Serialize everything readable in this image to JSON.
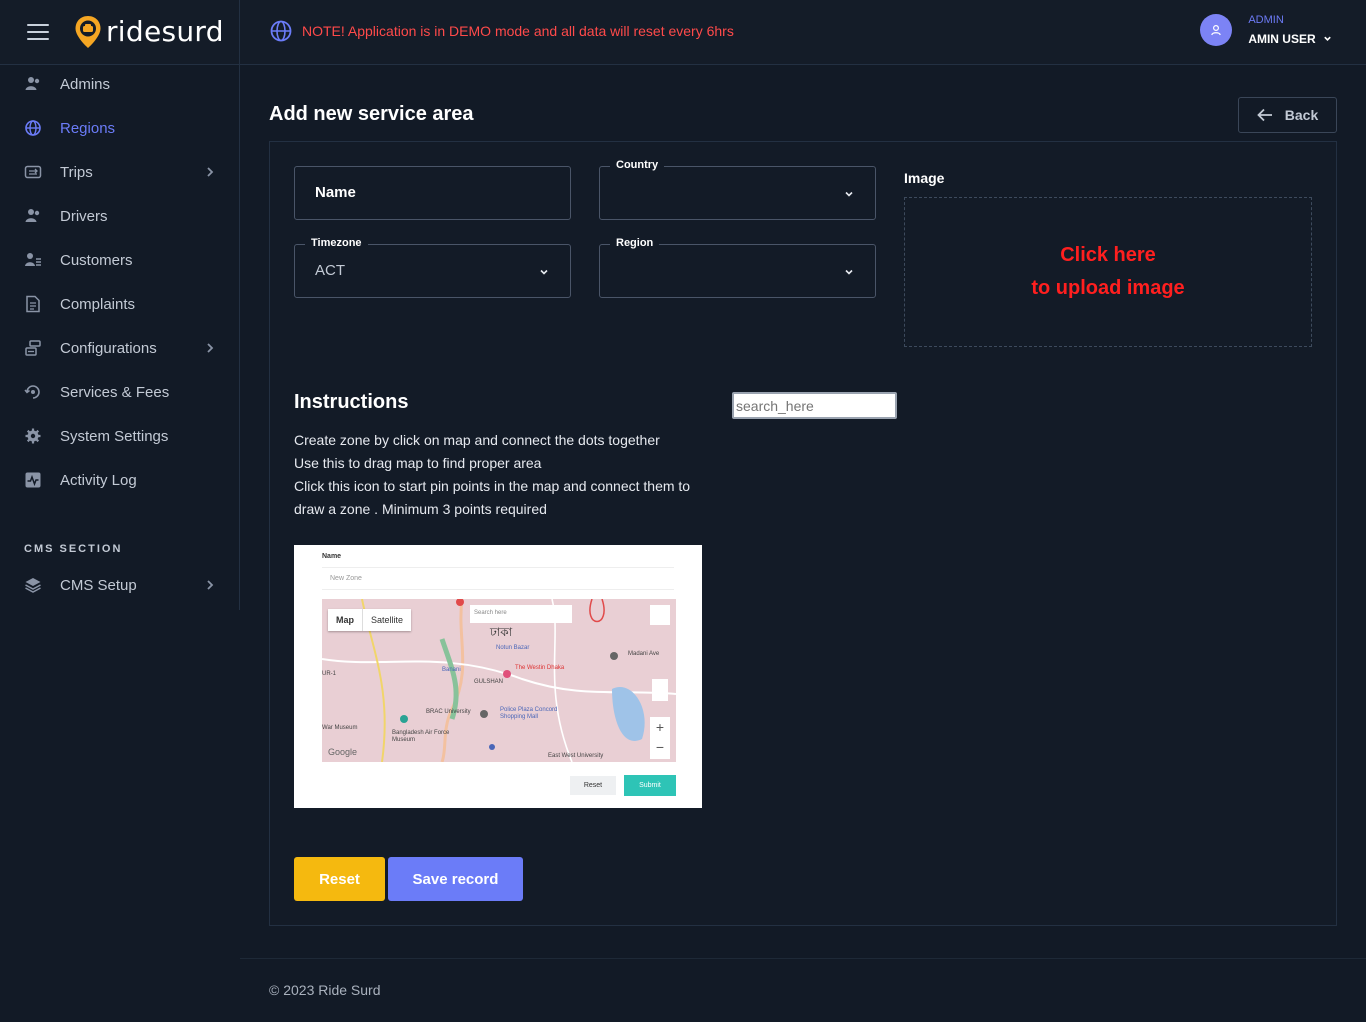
{
  "app": {
    "name": "ridesurd"
  },
  "notice": {
    "text": "NOTE! Application is in DEMO mode and all data will reset every 6hrs"
  },
  "user": {
    "role": "ADMIN",
    "name": "AMIN USER"
  },
  "sidebar": {
    "items": [
      {
        "label": "Admins",
        "icon": "admins-icon",
        "active": false
      },
      {
        "label": "Regions",
        "icon": "globe-icon",
        "active": true
      },
      {
        "label": "Trips",
        "icon": "trips-icon",
        "active": false,
        "has_children": true
      },
      {
        "label": "Drivers",
        "icon": "drivers-icon",
        "active": false
      },
      {
        "label": "Customers",
        "icon": "customers-icon",
        "active": false
      },
      {
        "label": "Complaints",
        "icon": "complaints-icon",
        "active": false
      },
      {
        "label": "Configurations",
        "icon": "configurations-icon",
        "active": false,
        "has_children": true
      },
      {
        "label": "Services & Fees",
        "icon": "services-icon",
        "active": false
      },
      {
        "label": "System Settings",
        "icon": "settings-icon",
        "active": false
      },
      {
        "label": "Activity Log",
        "icon": "activity-icon",
        "active": false
      }
    ],
    "cms_header": "CMS SECTION",
    "cms_items": [
      {
        "label": "CMS Setup",
        "icon": "layers-icon",
        "has_children": true
      }
    ]
  },
  "page": {
    "title": "Add new service area",
    "back_label": "Back"
  },
  "form": {
    "name_placeholder": "Name",
    "country_label": "Country",
    "country_value": "",
    "timezone_label": "Timezone",
    "timezone_value": "ACT",
    "region_label": "Region",
    "region_value": "",
    "image_label": "Image",
    "upload_line1": "Click here",
    "upload_line2": "to upload image"
  },
  "instructions": {
    "title": "Instructions",
    "lines": [
      "Create zone by click on map and connect the dots together",
      "Use this to drag map to find proper area",
      "Click this icon to start pin points in the map and connect them to draw a zone . Minimum 3 points required"
    ],
    "search_placeholder": "search_here"
  },
  "preview": {
    "name_label": "Name",
    "zone_placeholder": "New Zone",
    "tab_map": "Map",
    "tab_satellite": "Satellite",
    "search_placeholder": "Search here",
    "city": "ঢাকা",
    "places": [
      "Notun Bazar",
      "The Westin Dhaka",
      "Banani",
      "GULSHAN",
      "BRAC University",
      "Police Plaza Concord Shopping Mall",
      "War Museum",
      "Bangladesh Air Force Museum",
      "East West University",
      "Madani Ave",
      "UR-1"
    ],
    "brand": "Google",
    "reset_label": "Reset",
    "submit_label": "Submit"
  },
  "actions": {
    "reset_label": "Reset",
    "save_label": "Save record"
  },
  "footer": {
    "text": "© 2023 Ride Surd"
  },
  "colors": {
    "background": "#121a26",
    "accent": "#6b7cf8",
    "notice": "#ff4a4a",
    "reset_button": "#f5b90f",
    "upload_text": "#ff1f1f"
  }
}
